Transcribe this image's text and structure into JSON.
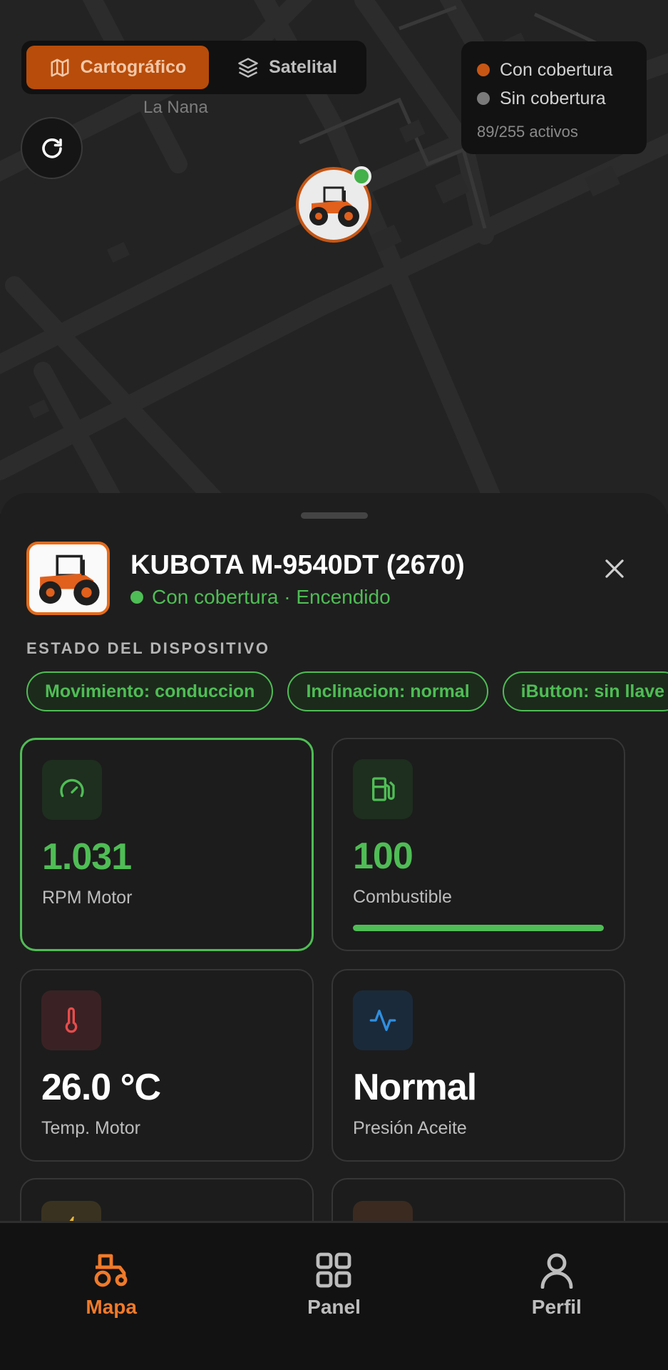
{
  "map": {
    "layers": [
      {
        "label": "Cartográfico",
        "active": true,
        "icon": "map-icon"
      },
      {
        "label": "Satelital",
        "active": false,
        "icon": "layers-icon"
      }
    ],
    "place_label": "La Nana",
    "legend": {
      "covered": "Con cobertura",
      "uncovered": "Sin cobertura",
      "count": "89/255 activos",
      "covered_color": "#c75614",
      "uncovered_color": "#7a7a7a"
    }
  },
  "device": {
    "name": "KUBOTA M-9540DT (2670)",
    "status": "Con cobertura · Encendido",
    "status_color": "#4fbd55",
    "section_title": "ESTADO DEL DISPOSITIVO",
    "chips": [
      "Movimiento: conduccion",
      "Inclinacion: normal",
      "iButton: sin llave"
    ]
  },
  "metrics": [
    {
      "value": "1.031",
      "label": "RPM Motor",
      "icon": "gauge-icon",
      "color": "#4fbd55"
    },
    {
      "value": "100",
      "label": "Combustible",
      "icon": "fuel-icon",
      "color": "#4fbd55",
      "fill_percent": 100
    },
    {
      "value": "26.0 °C",
      "label": "Temp. Motor",
      "icon": "thermometer-icon",
      "color": "#e84b4b"
    },
    {
      "value": "Normal",
      "label": "Presión Aceite",
      "icon": "activity-icon",
      "color": "#2f8fe0"
    }
  ],
  "nav": [
    {
      "label": "Mapa",
      "icon": "tractor-icon",
      "active": true
    },
    {
      "label": "Panel",
      "icon": "grid-icon",
      "active": false
    },
    {
      "label": "Perfil",
      "icon": "user-icon",
      "active": false
    }
  ]
}
